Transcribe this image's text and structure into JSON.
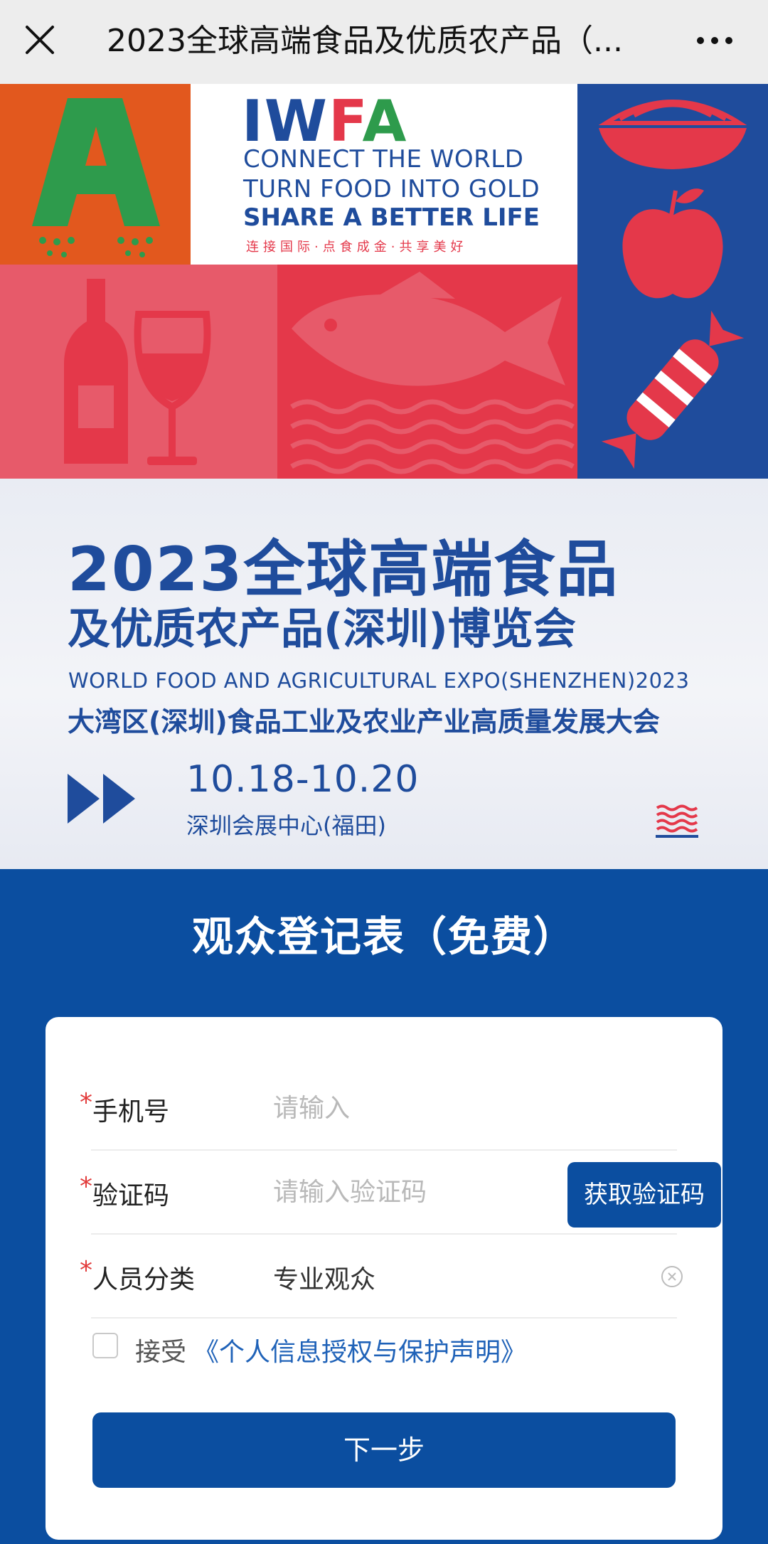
{
  "topbar": {
    "title": "2023全球高端食品及优质农产品（...",
    "close_icon": "close-icon",
    "more_icon": "more-icon"
  },
  "poster": {
    "logo": {
      "part1": "IW",
      "part2": "F",
      "part3": "A"
    },
    "slogan_line1": "CONNECT THE WORLD",
    "slogan_line2": "TURN FOOD INTO GOLD",
    "slogan_line3": "SHARE A BETTER LIFE",
    "slogan_cn": "连接国际·点食成金·共享美好",
    "title_line1": "2023全球高端食品",
    "title_line2": "及优质农产品(深圳)博览会",
    "title_en": "WORLD FOOD AND AGRICULTURAL EXPO(SHENZHEN)2023",
    "subtitle": "大湾区(深圳)食品工业及农业产业高质量发展大会",
    "date": "10.18-10.20",
    "venue": "深圳会展中心(福田)",
    "colors": {
      "blue": "#1f4c9c",
      "red": "#e4384a",
      "pink": "#e75a6a",
      "orange": "#e2581e",
      "green": "#2e9b4c"
    }
  },
  "form": {
    "heading": "观众登记表（免费）",
    "fields": [
      {
        "label": "手机号",
        "placeholder": "请输入",
        "value": "",
        "required_mark": "*"
      },
      {
        "label": "验证码",
        "placeholder": "请输入验证码",
        "value": "",
        "required_mark": "*",
        "button": "获取验证码"
      },
      {
        "label": "人员分类",
        "value": "专业观众",
        "required_mark": "*"
      }
    ],
    "agree_prefix": "接受",
    "agree_link": "《个人信息授权与保护声明》",
    "agree_checked": false,
    "submit": "下一步",
    "accent_color": "#0b4ea0"
  }
}
